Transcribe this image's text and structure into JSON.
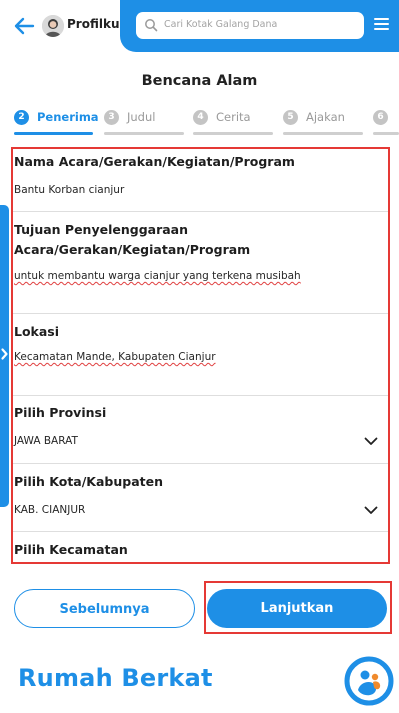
{
  "header": {
    "profile_label": "Profilku",
    "search_placeholder": "Cari Kotak Galang Dana",
    "accent_color": "#1e8fe6"
  },
  "page_title": "Bencana Alam",
  "steps": [
    {
      "number": "2",
      "label": "Penerima",
      "active": true
    },
    {
      "number": "3",
      "label": "Judul",
      "active": false
    },
    {
      "number": "4",
      "label": "Cerita",
      "active": false
    },
    {
      "number": "5",
      "label": "Ajakan",
      "active": false
    },
    {
      "number": "6",
      "label": "",
      "active": false
    }
  ],
  "form": {
    "event_name": {
      "label": "Nama Acara/Gerakan/Kegiatan/Program",
      "value": "Bantu Korban cianjur"
    },
    "purpose": {
      "label_line1": "Tujuan Penyelenggaraan",
      "label_line2": "Acara/Gerakan/Kegiatan/Program",
      "value": "untuk membantu warga cianjur yang terkena musibah"
    },
    "location": {
      "label": "Lokasi",
      "value": "Kecamatan Mande, Kabupaten Cianjur"
    },
    "province": {
      "label": "Pilih Provinsi",
      "value": "JAWA BARAT"
    },
    "city": {
      "label": "Pilih Kota/Kabupaten",
      "value": "KAB. CIANJUR"
    },
    "district": {
      "label": "Pilih Kecamatan"
    }
  },
  "buttons": {
    "prev_label": "Sebelumnya",
    "next_label": "Lanjutkan"
  },
  "footer": {
    "logo_text": "Rumah Berkat"
  },
  "icons": [
    "back-arrow-icon",
    "search-icon",
    "hamburger-menu-icon",
    "chevron-down-icon",
    "chevron-right-icon",
    "rumah-berkat-logo-icon"
  ]
}
